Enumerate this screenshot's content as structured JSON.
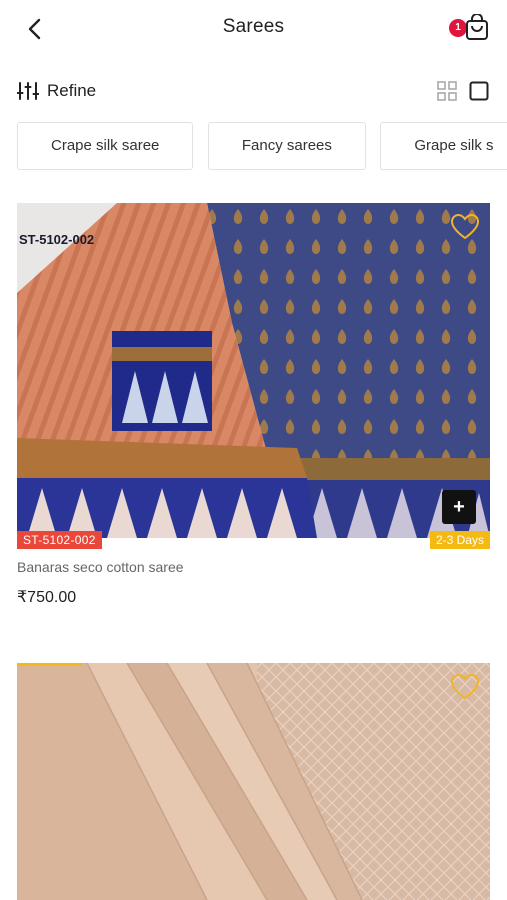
{
  "header": {
    "title": "Sarees",
    "cart_count": "1",
    "back_icon": "chevron-left-icon",
    "cart_icon": "shopping-bag-icon"
  },
  "toolbar": {
    "refine_label": "Refine",
    "refine_icon": "sliders-icon",
    "grid_icon": "grid-view-icon",
    "single_icon": "single-view-icon"
  },
  "categories": [
    "Crape silk saree",
    "Fancy sarees",
    "Grape silk s"
  ],
  "products": [
    {
      "image_code": "ST-5102-002",
      "sku": "ST-5102-002",
      "delivery": "2-3 Days",
      "name": "Banaras seco cotton saree",
      "price": "₹750.00"
    },
    {}
  ],
  "colors": {
    "badge": "#e0153b",
    "sku_tag": "#e8473a",
    "delivery_tag": "#f5b914",
    "favorite": "#f0b429"
  }
}
